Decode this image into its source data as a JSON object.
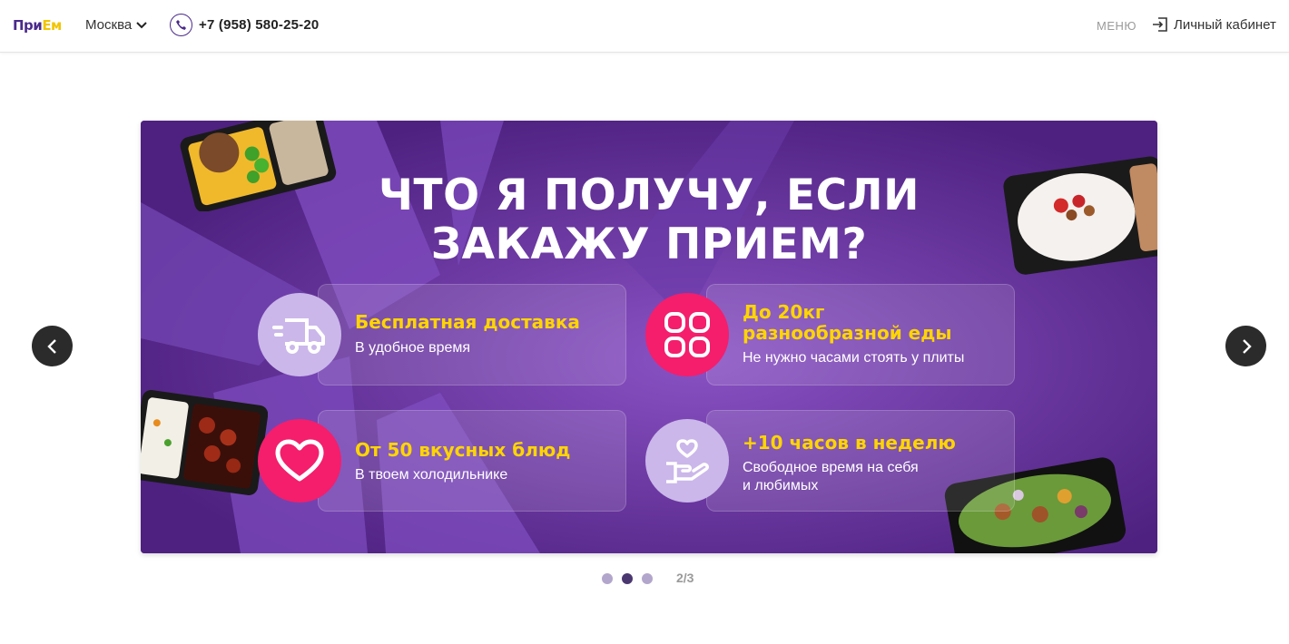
{
  "header": {
    "logo_part1": "При",
    "logo_part2": "Ем",
    "city": "Москва",
    "phone": "+7 (958) 580-25-20",
    "menu_label": "МЕНЮ",
    "cabinet_label": "Личный кабинет"
  },
  "banner": {
    "headline_line1": "ЧТО Я ПОЛУЧУ, ЕСЛИ",
    "headline_line2": "ЗАКАЖУ ПРИЕМ?",
    "features": [
      {
        "title": "Бесплатная доставка",
        "subtitle": "В удобное время",
        "icon": "truck-icon"
      },
      {
        "title_line1": "До 20кг",
        "title_line2": "разнообразной еды",
        "subtitle": "Не нужно часами стоять у плиты",
        "icon": "grid-icon"
      },
      {
        "title": "От 50 вкусных блюд",
        "subtitle": "В твоем холодильнике",
        "icon": "heart-icon"
      },
      {
        "title": "+10 часов в неделю",
        "subtitle_line1": "Свободное время на себя",
        "subtitle_line2": "и любимых",
        "icon": "hand-heart-icon"
      }
    ]
  },
  "slider": {
    "counter": "2/3",
    "current_slide": 2,
    "total_slides": 3
  },
  "colors": {
    "brand_purple": "#4b2a8c",
    "brand_yellow": "#ffd500",
    "accent_pink": "#f41e6c",
    "banner_purple": "#5b2a92"
  }
}
